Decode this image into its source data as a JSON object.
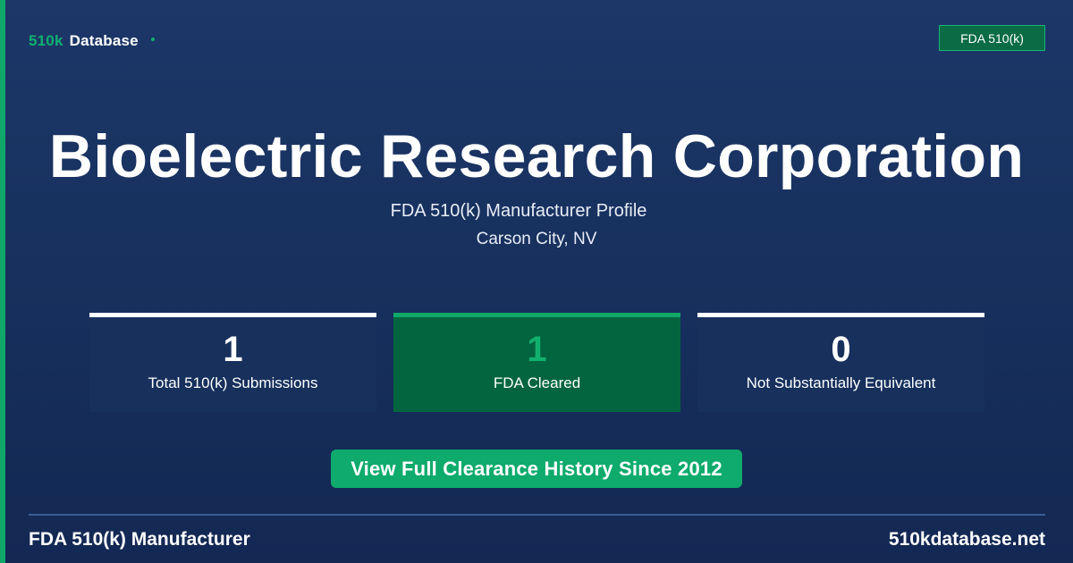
{
  "brand": {
    "prefix": "510k",
    "name": "Database",
    "accent_color": "#0fb070"
  },
  "badge": {
    "label": "FDA 510(k)"
  },
  "manufacturer": {
    "name": "Bioelectric Research Corporation",
    "subtitle": "FDA 510(k) Manufacturer Profile",
    "location": "Carson City, NV"
  },
  "stats": [
    {
      "value": "1",
      "label": "Total 510(k) Submissions"
    },
    {
      "value": "1",
      "label": "FDA Cleared"
    },
    {
      "value": "0",
      "label": "Not Substantially Equivalent"
    }
  ],
  "cta": {
    "label": "View Full Clearance History Since 2012"
  },
  "footer": {
    "left": "FDA 510(k) Manufacturer",
    "right": "510kdatabase.net"
  },
  "colors": {
    "background": "#17305d",
    "accent_green": "#0fa86a",
    "cleared_card": "#03653f"
  }
}
